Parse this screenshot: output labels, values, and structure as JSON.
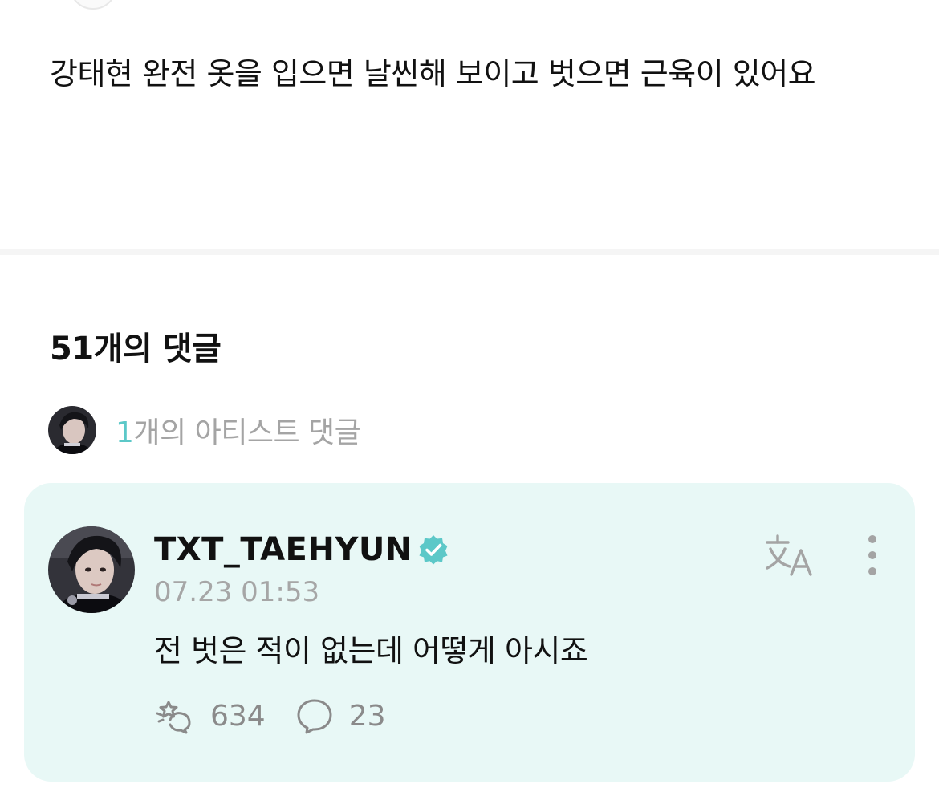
{
  "post": {
    "body_text": "강태현 완전 옷을 입으면 날씬해 보이고 벗으면 근육이 있어요"
  },
  "comments_section": {
    "title": "51개의 댓글",
    "artist_summary": {
      "count": "1",
      "label": "개의 아티스트 댓글"
    }
  },
  "comment": {
    "author": "TXT_TAEHYUN",
    "verified_icon": "verified-badge-icon",
    "timestamp": "07.23 01:53",
    "text": "전 벗은 적이 없는데 어떻게 아시죠",
    "likes_icon": "cheer-icon",
    "likes_count": "634",
    "replies_icon": "speech-bubble-icon",
    "replies_count": "23",
    "translate_icon": "translate-icon",
    "more_icon": "more-vertical-icon"
  },
  "colors": {
    "accent_teal": "#5cc8c8",
    "card_background": "#e8f8f6",
    "muted_text": "#a6a6a6",
    "primary_text": "#111111"
  }
}
